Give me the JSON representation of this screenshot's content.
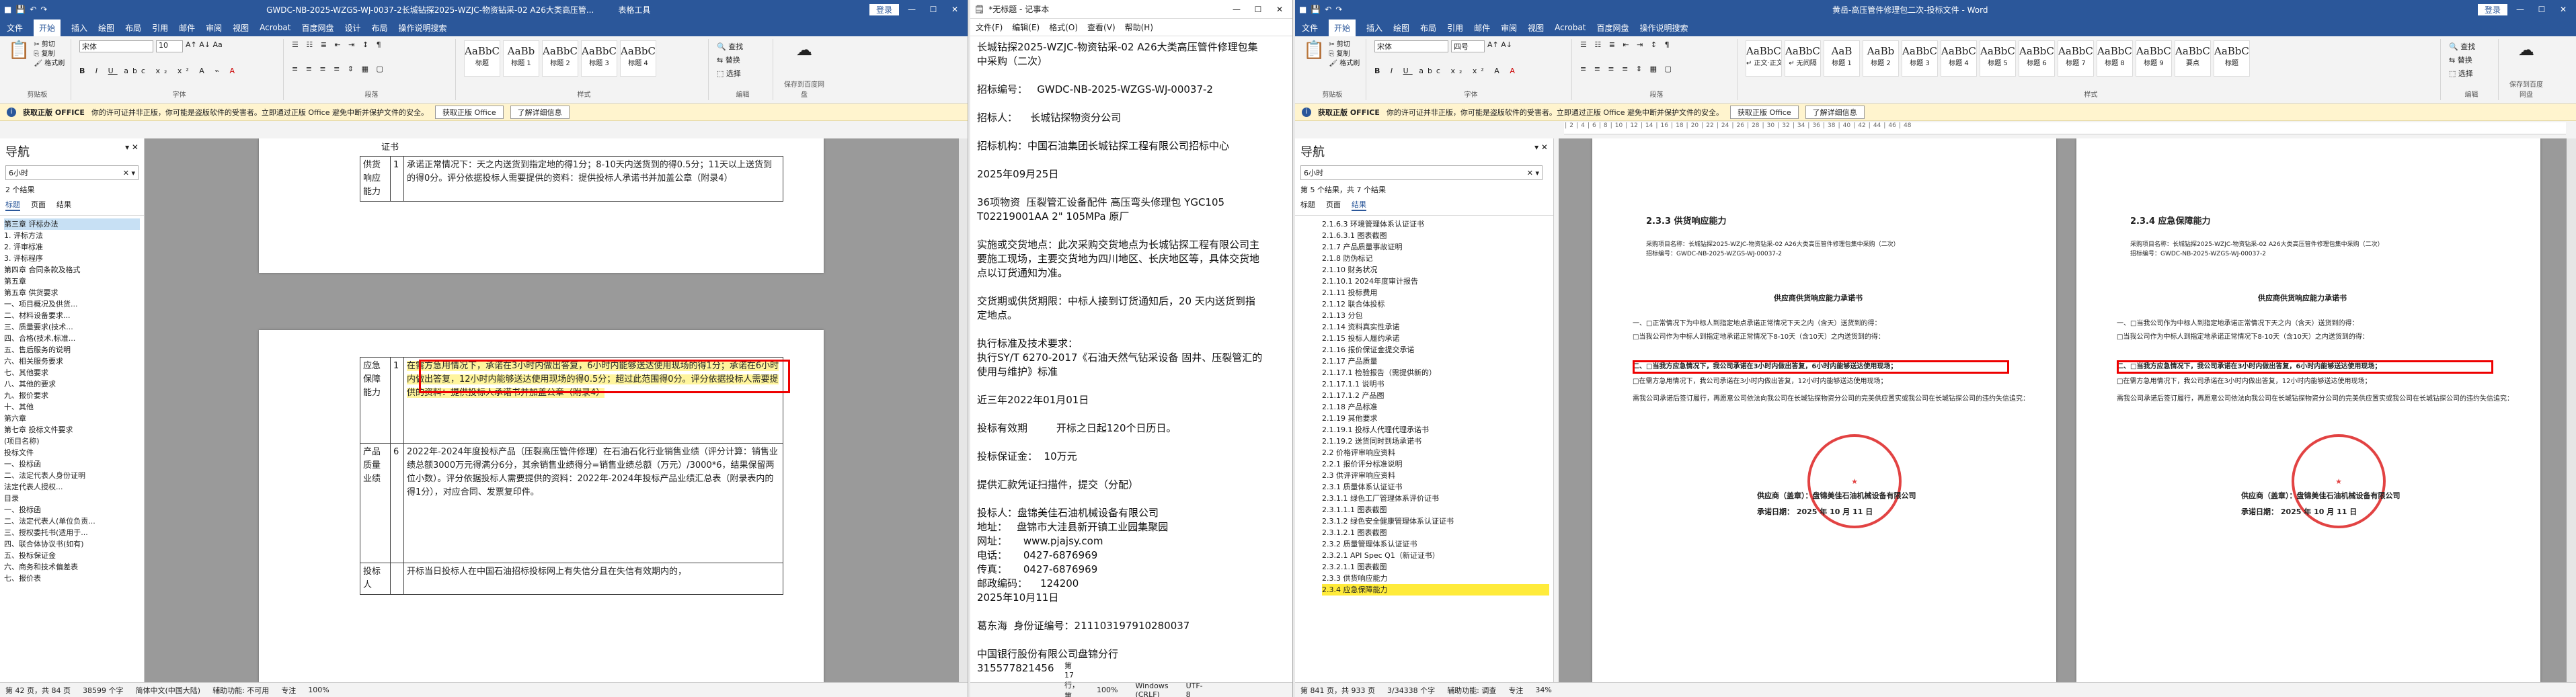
{
  "left_word": {
    "title": "GWDC-NB-2025-WZGS-WJ-0037-2长城钻探2025-WZJC-物资钻采-02 A26大类高压管...",
    "context_tab": "表格工具",
    "login": "登录",
    "tabs": [
      "文件",
      "开始",
      "插入",
      "绘图",
      "布局",
      "引用",
      "邮件",
      "审阅",
      "视图",
      "Acrobat",
      "百度网盘",
      "设计",
      "布局",
      "操作说明搜索"
    ],
    "font_name": "宋体",
    "font_size": "10",
    "styles": [
      {
        "p": "AaBbC",
        "n": "标题"
      },
      {
        "p": "AaBb",
        "n": "标题 1"
      },
      {
        "p": "AaBbC",
        "n": "标题 2"
      },
      {
        "p": "AaBbC",
        "n": "标题 3"
      },
      {
        "p": "AaBbC",
        "n": "标题 4"
      }
    ],
    "groups": [
      "剪贴板",
      "字体",
      "段落",
      "样式",
      "编辑",
      "保存",
      "保存到百度网盘"
    ],
    "edit": [
      "查找",
      "替换",
      "选择"
    ],
    "warn_title": "获取正版 OFFICE",
    "warn_text": "你的许可证并非正版，你可能是盗版软件的受害者。立即通过正版 Office 避免中断并保护文件的安全。",
    "warn_btn1": "获取正版 Office",
    "warn_btn2": "了解详细信息",
    "nav_title": "导航",
    "search": "6小时",
    "results": "2 个结果",
    "nav_tabs": [
      "标题",
      "页面",
      "结果"
    ],
    "nav_items": [
      "第三章 评标办法",
      "1. 评标方法",
      "2. 评审标准",
      "3. 评标程序",
      "第四章 合同条款及格式",
      "第五章",
      "第五章 供货要求",
      "一、项目概况及供货...",
      "二、材料设备要求...",
      "三、质量要求(技术...",
      "四、合格(技术,标准...",
      "五、售后服务的说明",
      "六、相关服务要求",
      "七、其他要求",
      "八、其他的要求",
      "九、报价要求",
      "十、其他",
      "第六章",
      "第七章 投标文件要求",
      "(项目名称)",
      "投标文件",
      "一、投标函",
      "二、法定代表人身份证明",
      "法定代表人授权...",
      "目录",
      "一、投标函",
      "二、法定代表人(单位负责...",
      "三、授权委托书(适用于...",
      "四、联合体协议书(如有)",
      "五、投标保证金",
      "六、商务和技术偏差表",
      "七、报价表"
    ],
    "rows": [
      {
        "c1": "供货响应能力",
        "c2": "1",
        "c3": "承诺正常情况下：天之内送货到指定地的得1分；8-10天内送货到的得0.5分；11天以上送货到的得0分。评分依据投标人需要提供的资料：提供投标人承诺书并加盖公章（附录4）"
      },
      {
        "c1": "应急保障能力",
        "c2": "1",
        "c3": "在需方急用情况下，承诺在3小时内做出答复，6小时内能够送达使用现场的得1分；承诺在6小时内做出答复，12小时内能够送达使用现场的得0.5分；超过此范围得0分。评分依据投标人需要提供的资料：提供投标人承诺书并加盖公章（附录4）"
      },
      {
        "c1": "产品质量业绩",
        "c2": "6",
        "c3": "2022年-2024年度投标产品（压裂高压管件修理）在石油石化行业销售业绩（评分计算：销售业绩总额3000万元得满分6分，其余销售业绩得分=销售业绩总额（万元）/3000*6，结果保留两位小数）。评分依据投标人需要提供的资料：2022年-2024年投标产品业绩汇总表（附录表内的得1分），对应合同、发票复印件。"
      },
      {
        "c1": "投标人",
        "c2": "",
        "c3": "开标当日投标人在中国石油招标投标网上有失信分且在失信有效期内的，"
      }
    ],
    "doc_frag": "证书",
    "status": [
      "第 42 页，共 84 页",
      "38599 个字",
      "简体中文(中国大陆)",
      "辅助功能: 不可用",
      "专注",
      "100%"
    ]
  },
  "notepad": {
    "title": "*无标题 - 记事本",
    "menu": [
      "文件(F)",
      "编辑(E)",
      "格式(O)",
      "查看(V)",
      "帮助(H)"
    ],
    "lines": [
      "长城钻探2025-WZJC-物资钻采-02 A26大类高压管件修理包集",
      "中采购（二次）",
      "",
      "招标编号：   GWDC-NB-2025-WZGS-WJ-00037-2",
      "",
      "招标人：    长城钻探物资分公司",
      "",
      "招标机构：中国石油集团长城钻探工程有限公司招标中心",
      "",
      "2025年09月25日",
      "",
      "36项物资  压裂管汇设备配件 高压弯头修理包 YGC105",
      "T02219001AA 2\" 105MPa 原厂",
      "",
      "实施或交货地点：此次采购交货地点为长城钻探工程有限公司主",
      "要施工现场，主要交货地为四川地区、长庆地区等，具体交货地",
      "点以订货通知为准。",
      "",
      "交货期或供货期限：中标人接到订货通知后，20 天内送货到指",
      "定地点。",
      "",
      "执行标准及技术要求：",
      "执行SY/T 6270-2017《石油天然气钻采设备 固井、压裂管汇的",
      "使用与维护》标准",
      "",
      "近三年2022年01月01日",
      "",
      "投标有效期         开标之日起120个日历日。",
      "",
      "投标保证金：  10万元",
      "",
      "提供汇款凭证扫描件，提交（分配）",
      "",
      "投标人：盘锦美佳石油机械设备有限公司",
      "地址：   盘锦市大洼县新开镇工业园集聚园",
      "网址：     www.pjajsy.com",
      "电话：     0427-6876969",
      "传真：     0427-6876969",
      "邮政编码：    124200",
      "2025年10月11日",
      "",
      "葛东海  身份证编号：211103197910280037",
      "",
      "中国银行股份有限公司盘锦分行",
      "315577821456"
    ],
    "status": [
      "第 17 行，第 11 列",
      "100%",
      "Windows (CRLF)",
      "UTF-8"
    ]
  },
  "right_word": {
    "title": "黄岳-高压管件修理包二次-投标文件 - Word",
    "login": "登录",
    "tabs": [
      "文件",
      "开始",
      "插入",
      "绘图",
      "布局",
      "引用",
      "邮件",
      "审阅",
      "视图",
      "Acrobat",
      "百度网盘",
      "操作说明搜索"
    ],
    "font_name": "宋体",
    "font_size": "四号",
    "styles": [
      {
        "p": "AaBbCcD",
        "n": "↵ 正文·正文"
      },
      {
        "p": "AaBbCcDc",
        "n": "↵ 无间隔"
      },
      {
        "p": "AaB",
        "n": "标题 1"
      },
      {
        "p": "AaBb",
        "n": "标题 2"
      },
      {
        "p": "AaBbC",
        "n": "标题 3"
      },
      {
        "p": "AaBbCcI",
        "n": "标题 4"
      },
      {
        "p": "AaBbCc",
        "n": "标题 5"
      },
      {
        "p": "AaBbCc",
        "n": "标题 6"
      },
      {
        "p": "AaBbCcI",
        "n": "标题 7"
      },
      {
        "p": "AaBbCcI",
        "n": "标题 8"
      },
      {
        "p": "AaBbCcI",
        "n": "标题 9"
      },
      {
        "p": "AaBbCcDc",
        "n": "要点"
      },
      {
        "p": "AaBbCcI",
        "n": "标题"
      }
    ],
    "nav_title": "导航",
    "search": "6小时",
    "results": "第 5 个结果，共 7 个结果",
    "nav_tabs": [
      "标题",
      "页面",
      "结果"
    ],
    "nav_items": [
      "2.1.6.3 环境管理体系认证证书",
      "2.1.6.3.1 图表截图",
      "2.1.7 产品质量事故证明",
      "2.1.8 防伪标记",
      "2.1.10 财务状况",
      "2.1.10.1 2024年度审计报告",
      "2.1.11 投标费用",
      "2.1.12 联合体投标",
      "2.1.13 分包",
      "2.1.14 资料真实性承诺",
      "2.1.15 投标人履约承诺",
      "2.1.16 报价保证金提交承诺",
      "2.1.17 产品质量",
      "2.1.17.1 检验报告（需提供新的）",
      "2.1.17.1.1 说明书",
      "2.1.17.1.2 产品图",
      "2.1.18 产品标准",
      "2.1.19 其他要求",
      "2.1.19.1 投标人代理代理承诺书",
      "2.1.19.2 送货同时到场承诺书",
      "2.2 价格评审响应资料",
      "2.2.1 报价评分标准说明",
      "2.3 供评评审响应资料",
      "2.3.1 质量体系认证证书",
      "2.3.1.1 绿色工厂管理体系评价证书",
      "2.3.1.1.1 图表截图",
      "2.3.1.2 绿色安全健康管理体系认证证书",
      "2.3.1.2.1 图表截图",
      "2.3.2 质量管理体系认证证书",
      "2.3.2.1 API Spec Q1（新证证书）",
      "2.3.2.1.1 图表截图",
      "2.3.3 供货响应能力",
      "2.3.4 应急保障能力"
    ],
    "page_heading": "2.3.3 供货响应能力",
    "page_heading2": "2.3.4 应急保障能力",
    "page_header": "采购项目名称：长城钻探2025-WZJC-物资钻采-02 A26大类高压管件修理包集中采购（二次）",
    "page_header2": "招标编号：GWDC-NB-2025-WZGS-WJ-00037-2",
    "commit_title": "供应商供货响应能力承诺书",
    "left_lines": [
      "一、□正常情况下为中标人到指定地点承诺正常情况下天之内（含天）送货到的得：",
      "□当我公司作为中标人到指定地承诺正常情况下8-10天（含10天）之内送货到的得：",
      "二、□当我方应急情况下，我公司承诺在3小时内做出答复，6小时内能够送达使用现场；",
      "□在需方急用情况下，我公司承诺在3小时内做出答复，12小时内能够送达使用现场；",
      "需我公司承诺后签订履行，再愿意公司依法向我公司在长城钻探物资分公司的完美供应置实或我公司在长城钻探公司的违约失信追究："
    ],
    "right_lines": [
      "一、□当我公司作为中标人到指定地承诺正常情况下天之内（含天）送货到的得：",
      "□当我公司作为中标人到指定地承诺正常情况下8-10天（含10天）之内送货到的得：",
      "二、□当我方应急情况下，我公司承诺在3小时内做出答复，6小时内能够送达使用现场；",
      "□在需方急用情况下，我公司承诺在3小时内做出答复，12小时内能够送达使用现场；",
      "需我公司承诺后签订履行，再愿意公司依法向我公司在长城钻探物资分公司的完美供应置实或我公司在长城钻探公司的违约失信追究："
    ],
    "signer": "供应商（盖章）：盘锦美佳石油机械设备有限公司",
    "sign_date": "承诺日期：   2025 年 10 月 11 日",
    "stamp_text": "盘锦美佳石油机械设备有限公司",
    "status": [
      "第 841 页，共 933 页",
      "3/34338 个字",
      "辅助功能: 调查",
      "专注",
      "34%"
    ]
  }
}
